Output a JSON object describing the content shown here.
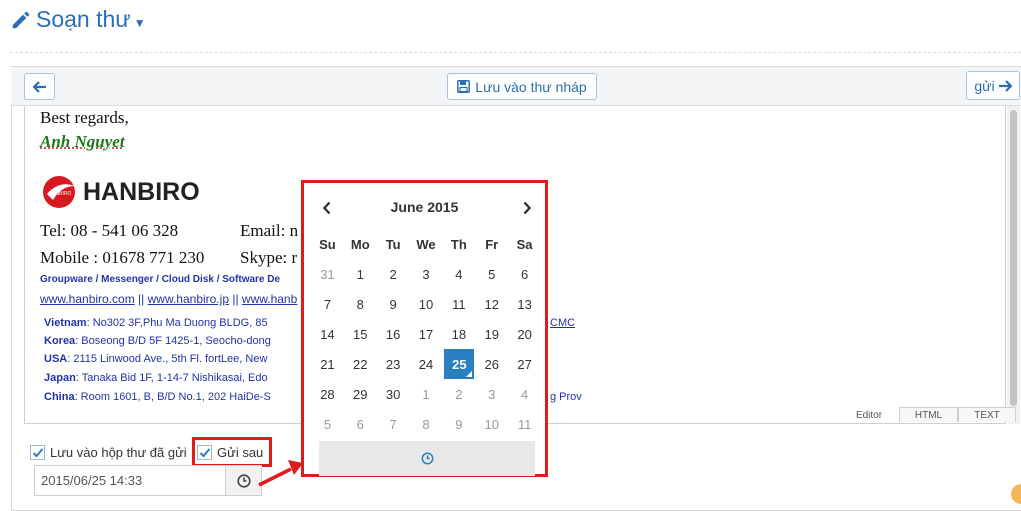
{
  "header": {
    "title": "Soạn thư"
  },
  "toolbar": {
    "draft_label": "Lưu vào thư nháp",
    "send_label": "gửi"
  },
  "signature": {
    "regards": "Best regards,",
    "name": "Anh Nguyet",
    "logo_text": "HANBIRO",
    "logo_badge": "HANBIRO",
    "tel": "Tel: 08 - 541 06 328",
    "email": "Email: n",
    "mobile": "Mobile : 01678 771 230",
    "skype": "Skype: r",
    "services": "Groupware / Messenger / Cloud Disk / Software De",
    "links": [
      "www.hanbiro.com",
      "www.hanbiro.jp",
      "www.hanb"
    ],
    "link_sep": " || ",
    "offices": [
      {
        "country": "Vietnam",
        "address": ": No302 3F,Phu Ma Duong BLDG, 85"
      },
      {
        "country": "Korea",
        "address": ": Boseong B/D 5F 1425-1, Seocho-dong"
      },
      {
        "country": "USA",
        "address": ": 2115 Linwood Ave., 5th Fl. fortLee, New"
      },
      {
        "country": "Japan",
        "address": ": Tanaka Bid 1F, 1-14-7 Nishikasai, Edo"
      },
      {
        "country": "China",
        "address": ": Room 1601, B, B/D No.1, 202 HaiDe-S"
      }
    ],
    "office_tails": [
      "CMC",
      "g Prov"
    ]
  },
  "editor_tabs": [
    "Editor",
    "HTML",
    "TEXT"
  ],
  "options": {
    "save_sent_label": "Lưu vào hộp thư đã gửi",
    "send_later_label": "Gửi sau",
    "datetime_value": "2015/06/25 14:33"
  },
  "calendar": {
    "month_label": "June 2015",
    "weekdays": [
      "Su",
      "Mo",
      "Tu",
      "We",
      "Th",
      "Fr",
      "Sa"
    ],
    "weeks": [
      [
        "31",
        "1",
        "2",
        "3",
        "4",
        "5",
        "6"
      ],
      [
        "7",
        "8",
        "9",
        "10",
        "11",
        "12",
        "13"
      ],
      [
        "14",
        "15",
        "16",
        "17",
        "18",
        "19",
        "20"
      ],
      [
        "21",
        "22",
        "23",
        "24",
        "25",
        "26",
        "27"
      ],
      [
        "28",
        "29",
        "30",
        "1",
        "2",
        "3",
        "4"
      ],
      [
        "5",
        "6",
        "7",
        "8",
        "9",
        "10",
        "11"
      ]
    ],
    "selected": "25"
  },
  "colors": {
    "accent": "#2a6fb5",
    "selected_day": "#2a7fc0",
    "highlight": "#e01b1b"
  }
}
